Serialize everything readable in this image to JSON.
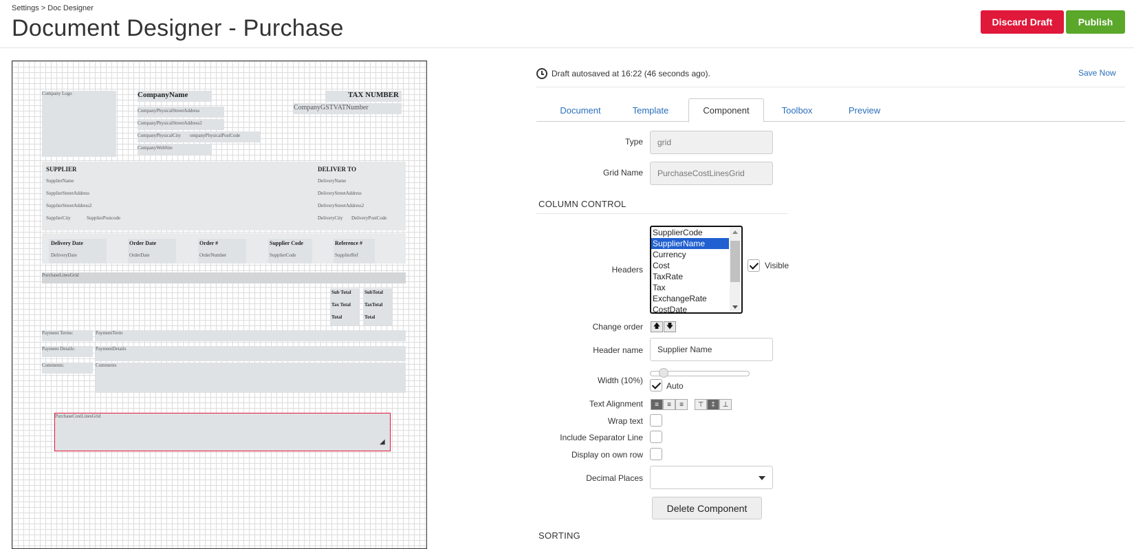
{
  "breadcrumb": "Settings > Doc Designer",
  "page_title": "Document Designer - Purchase",
  "actions": {
    "discard": "Discard Draft",
    "publish": "Publish"
  },
  "autosave": {
    "text": "Draft autosaved at 16:22 (46 seconds ago).",
    "save_now": "Save Now"
  },
  "tabs": [
    "Document",
    "Template",
    "Component",
    "Toolbox",
    "Preview"
  ],
  "active_tab": "Component",
  "form": {
    "type_label": "Type",
    "type_value": "grid",
    "grid_name_label": "Grid Name",
    "grid_name_value": "PurchaseCostLinesGrid",
    "column_control": "COLUMN CONTROL",
    "headers_label": "Headers",
    "headers_options": [
      "SupplierCode",
      "SupplierName",
      "Currency",
      "Cost",
      "TaxRate",
      "Tax",
      "ExchangeRate",
      "CostDate"
    ],
    "headers_selected": "SupplierName",
    "visible_label": "Visible",
    "change_order_label": "Change order",
    "header_name_label": "Header name",
    "header_name_value": "Supplier Name",
    "width_label": "Width (10%)",
    "auto_label": "Auto",
    "text_alignment_label": "Text Alignment",
    "wrap_text_label": "Wrap text",
    "separator_label": "Include Separator Line",
    "own_row_label": "Display on own row",
    "decimal_label": "Decimal Places",
    "delete_label": "Delete Component",
    "sorting": "SORTING"
  },
  "canvas": {
    "company_logo": "Company Logo",
    "company_name": "CompanyName",
    "addr1": "CompanyPhysicalStreetAddress",
    "addr2": "CompanyPhysicalStreetAddress2",
    "city": "CompanyPhysicalCity",
    "postcode": "ompanyPhysicalPostCode",
    "website": "CompanyWebSite",
    "tax_number": "TAX NUMBER",
    "gst": "CompanyGSTVATNumber",
    "supplier": "SUPPLIER",
    "supplier_name": "SupplierName",
    "supplier_addr": "SupplierStreetAddress",
    "supplier_addr2": "SupplierStreetAddress2",
    "supplier_city": "SupplierCity",
    "supplier_postcode": "SupplierPostcode",
    "deliver_to": "DELIVER TO",
    "delivery_name": "DeliveryName",
    "delivery_addr": "DeliveryStreetAddress",
    "delivery_addr2": "DeliveryStreetAddress2",
    "delivery_city": "DeliveryCity",
    "delivery_postcode": "DeliveryPostCode",
    "delivery_date_h": "Delivery Date",
    "delivery_date": "DeliveryDate",
    "order_date_h": "Order Date",
    "order_date": "OrderDate",
    "order_no_h": "Order #",
    "order_no": "OrderNumber",
    "supplier_code_h": "Supplier Code",
    "supplier_code": "SupplierCode",
    "reference_h": "Reference #",
    "reference": "SupplierRef",
    "purchase_lines": "PurchaseLinesGrid",
    "sub_total_h": "Sub Total",
    "sub_total": "SubTotal",
    "tax_total_h": "Tax Total",
    "tax_total": "TaxTotal",
    "total_h": "Total",
    "total": "Total",
    "payment_terms_h": "Payment Terms:",
    "payment_terms": "PaymentTerm",
    "payment_details_h": "Payment Details:",
    "payment_details": "PaymentDetails",
    "comments_h": "Comments:",
    "comments": "Comments",
    "cost_lines": "PurchaseCostLinesGrid"
  }
}
